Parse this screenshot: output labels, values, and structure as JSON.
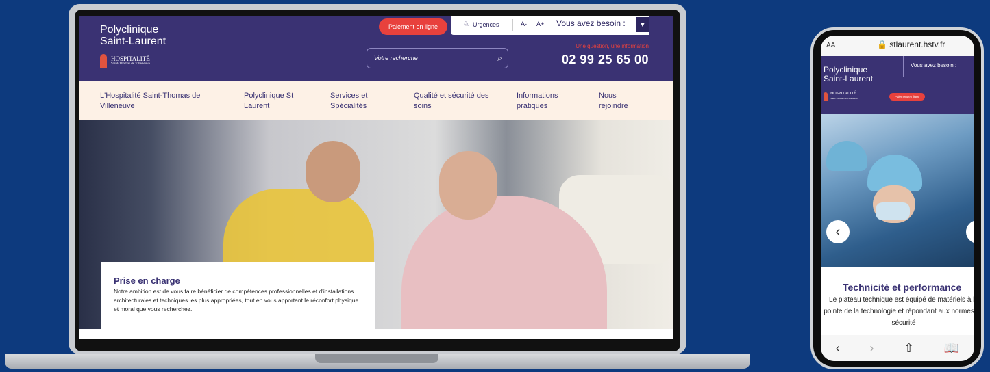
{
  "laptop": {
    "logo_line1": "Polyclinique",
    "logo_line2": "Saint-Laurent",
    "hospitalite": "HOSPITALITÉ",
    "hospitalite_sub": "Saint-Thomas de Villeneuve",
    "pay_button": "Paiement en ligne",
    "urgences": "Urgences",
    "font_minus": "A-",
    "font_plus": "A+",
    "need_label": "Vous avez besoin :",
    "search_placeholder": "Votre recherche",
    "question": "Une question, une information",
    "phone": "02 99 25 65 00",
    "nav": [
      {
        "line1": "L'Hospitalité Saint-Thomas de",
        "line2": "Villeneuve"
      },
      {
        "line1": "Polyclinique St",
        "line2": "Laurent"
      },
      {
        "line1": "Services et",
        "line2": "Spécialités"
      },
      {
        "line1": "Qualité et sécurité des",
        "line2": "soins"
      },
      {
        "line1": "Informations",
        "line2": "pratiques"
      },
      {
        "line1": "Nous",
        "line2": "rejoindre"
      }
    ],
    "caption_title": "Prise en charge",
    "caption_text": "Notre ambition est de vous faire bénéficier de compétences professionnelles et d'installations architecturales et techniques les plus appropriées, tout en vous apportant le réconfort physique et moral que vous recherchez."
  },
  "phone": {
    "aa": "AA",
    "url": "🔒 stlaurent.hstv.fr",
    "logo_line1": "Polyclinique",
    "logo_line2": "Saint-Laurent",
    "need_label": "Vous avez besoin :",
    "hospitalite": "HOSPITALITÉ",
    "hospitalite_sub": "Saint-Thomas de Villeneuve",
    "pay_button": "Paiement en ligne",
    "title": "Technicité et performance",
    "text": "Le plateau technique est équipé de matériels à la pointe de la technologie et répondant aux normes de sécurité"
  },
  "icons": {
    "search": "⌕",
    "urgences": "♘",
    "dropdown": "▼",
    "back": "‹",
    "forward": "›",
    "share": "⇧",
    "bookmarks": "📖",
    "menu": "⋮"
  },
  "colors": {
    "brand_purple": "#3a3273",
    "accent_red": "#e8413d",
    "nav_bg": "#fdf1e6",
    "background": "#0d3a7e"
  }
}
